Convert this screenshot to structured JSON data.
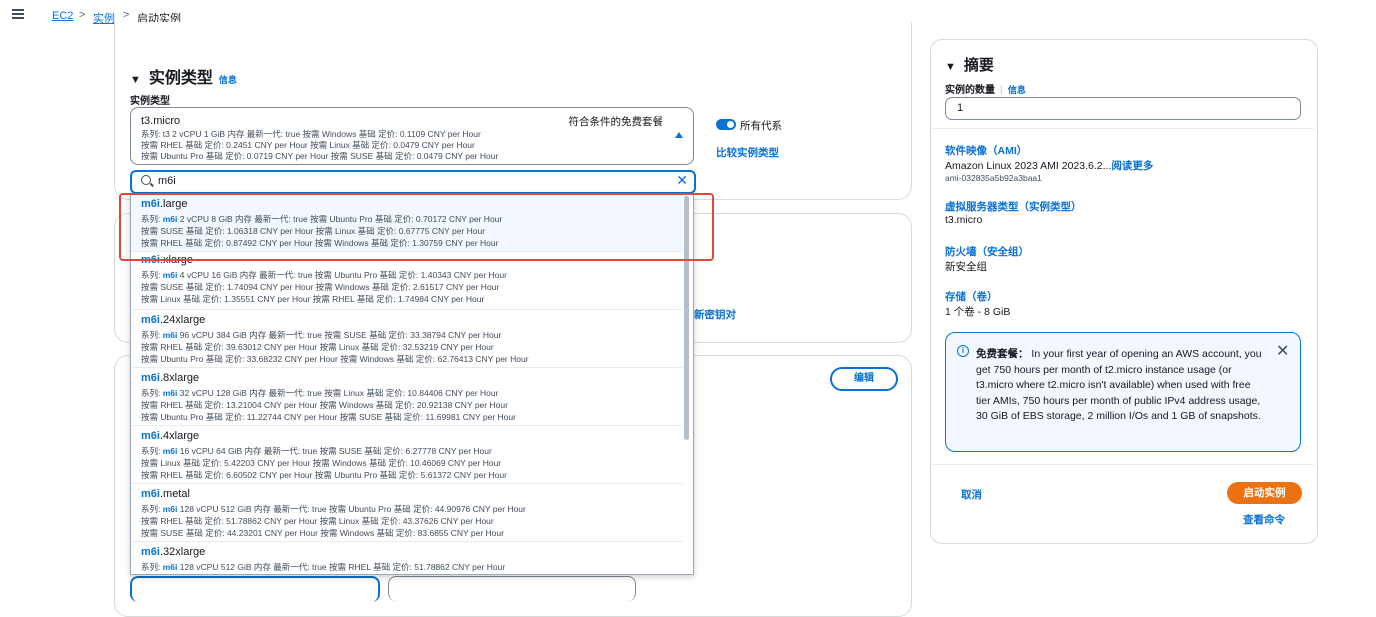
{
  "breadcrumb": {
    "items": [
      "EC2",
      "实例",
      "启动实例"
    ],
    "separator": ">"
  },
  "instance_type_section": {
    "title": "实例类型",
    "info": "信息",
    "field_label": "实例类型",
    "selected": {
      "name": "t3.micro",
      "free_tier_tag": "符合条件的免费套餐",
      "lines": [
        "系列: t3    2 vCPU    1 GiB 内存    最新一代: true        按需 Windows 基础 定价: 0.1109 CNY per Hour",
        "按需 RHEL 基础 定价: 0.2451 CNY per Hour    按需 Linux 基础 定价: 0.0479 CNY per Hour",
        "按需 Ubuntu Pro 基础 定价: 0.0719 CNY per Hour    按需 SUSE 基础 定价: 0.0479 CNY per Hour"
      ]
    },
    "toggle_label": "所有代系",
    "compare_link": "比较实例类型",
    "search_value": "m6i",
    "options": [
      {
        "prefix": "m6i",
        "suffix": ".large",
        "l1_pre": "系列: ",
        "family": "m6i",
        "l1_post": "    2 vCPU    8 GiB 内存    最新一代: true        按需 Ubuntu Pro 基础 定价: 0.70172 CNY per Hour",
        "l2": "按需 SUSE 基础 定价: 1.06318 CNY per Hour    按需 Linux 基础 定价: 0.67775 CNY per Hour",
        "l3": "按需 RHEL 基础 定价: 0.87492 CNY per Hour    按需 Windows 基础 定价: 1.30759 CNY per Hour"
      },
      {
        "prefix": "m6i",
        "suffix": ".xlarge",
        "l1_pre": "系列: ",
        "family": "m6i",
        "l1_post": "    4 vCPU    16 GiB 内存    最新一代: true        按需 Ubuntu Pro 基础 定价: 1.40343 CNY per Hour",
        "l2": "按需 SUSE 基础 定价: 1.74094 CNY per Hour    按需 Windows 基础 定价: 2.61517 CNY per Hour",
        "l3": "按需 Linux 基础 定价: 1.35551 CNY per Hour    按需 RHEL 基础 定价: 1.74984 CNY per Hour"
      },
      {
        "prefix": "m6i",
        "suffix": ".24xlarge",
        "l1_pre": "系列: ",
        "family": "m6i",
        "l1_post": "    96 vCPU    384 GiB 内存    最新一代: true        按需 SUSE 基础 定价: 33.38794 CNY per Hour",
        "l2": "按需 RHEL 基础 定价: 39.63012 CNY per Hour    按需 Linux 基础 定价: 32.53219 CNY per Hour",
        "l3": "按需 Ubuntu Pro 基础 定价: 33.68232 CNY per Hour    按需 Windows 基础 定价: 62.76413 CNY per Hour"
      },
      {
        "prefix": "m6i",
        "suffix": ".8xlarge",
        "l1_pre": "系列: ",
        "family": "m6i",
        "l1_post": "    32 vCPU    128 GiB 内存    最新一代: true        按需 Linux 基础 定价: 10.84406 CNY per Hour",
        "l2": "按需 RHEL 基础 定价: 13.21004 CNY per Hour    按需 Windows 基础 定价: 20.92138 CNY per Hour",
        "l3": "按需 Ubuntu Pro 基础 定价: 11.22744 CNY per Hour    按需 SUSE 基础 定价: 11.69981 CNY per Hour"
      },
      {
        "prefix": "m6i",
        "suffix": ".4xlarge",
        "l1_pre": "系列: ",
        "family": "m6i",
        "l1_post": "    16 vCPU    64 GiB 内存    最新一代: true        按需 SUSE 基础 定价: 6.27778 CNY per Hour",
        "l2": "按需 Linux 基础 定价: 5.42203 CNY per Hour    按需 Windows 基础 定价: 10.46069 CNY per Hour",
        "l3": "按需 RHEL 基础 定价: 6.60502 CNY per Hour    按需 Ubuntu Pro 基础 定价: 5.61372 CNY per Hour"
      },
      {
        "prefix": "m6i",
        "suffix": ".metal",
        "l1_pre": "系列: ",
        "family": "m6i",
        "l1_post": "    128 vCPU    512 GiB 内存    最新一代: true        按需 Ubuntu Pro 基础 定价: 44.90976 CNY per Hour",
        "l2": "按需 RHEL 基础 定价: 51.78862 CNY per Hour    按需 Linux 基础 定价: 43.37626 CNY per Hour",
        "l3": "按需 SUSE 基础 定价: 44.23201 CNY per Hour    按需 Windows 基础 定价: 83.6855 CNY per Hour"
      },
      {
        "prefix": "m6i",
        "suffix": ".32xlarge",
        "l1_pre": "系列: ",
        "family": "m6i",
        "l1_post": "    128 vCPU    512 GiB 内存    最新一代: true        按需 RHEL 基础 定价: 51.78862 CNY per Hour",
        "l2": "",
        "l3": ""
      }
    ]
  },
  "background": {
    "new_key_link": "新密钥对",
    "edit_button": "编辑"
  },
  "summary": {
    "title": "摘要",
    "count_label": "实例的数量",
    "count_info": "信息",
    "count_value": "1",
    "ami_title": "软件映像（AMI）",
    "ami_value": "Amazon Linux 2023 AMI 2023.6.2...",
    "ami_read_more": "阅读更多",
    "ami_id": "ami-032835a5b92a3baa1",
    "vm_title": "虚拟服务器类型（实例类型）",
    "vm_value": "t3.micro",
    "fw_title": "防火墙（安全组）",
    "fw_value": "新安全组",
    "storage_title": "存储（卷）",
    "storage_value": "1 个卷 - 8 GiB",
    "notice_bold": "免费套餐：",
    "notice_text": "In your first year of opening an AWS account, you get 750 hours per month of t2.micro instance usage (or t3.micro where t2.micro isn't available) when used with free tier AMIs, 750 hours per month of public IPv4 address usage, 30 GiB of EBS storage, 2 million I/Os and 1 GB of snapshots.",
    "cancel": "取消",
    "launch": "启动实例",
    "view_commands": "查看命令"
  },
  "colors": {
    "accent": "#0972d3",
    "launch": "#ec7211",
    "highlight": "#e0473f"
  }
}
